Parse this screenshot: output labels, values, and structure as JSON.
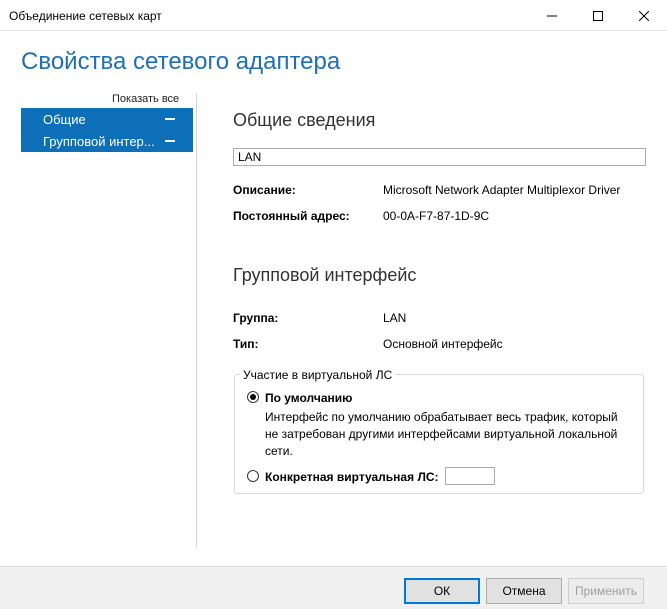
{
  "window": {
    "title": "Объединение сетевых карт"
  },
  "page": {
    "heading": "Свойства сетевого адаптера"
  },
  "nav": {
    "show_all": "Показать все",
    "items": [
      {
        "label": "Общие"
      },
      {
        "label": "Групповой интер..."
      }
    ]
  },
  "general": {
    "title": "Общие сведения",
    "name_value": "LAN",
    "description_label": "Описание:",
    "description_value": "Microsoft Network Adapter Multiplexor Driver",
    "address_label": "Постоянный адрес:",
    "address_value": "00-0A-F7-87-1D-9C"
  },
  "team_interface": {
    "title": "Групповой интерфейс",
    "group_label": "Группа:",
    "group_value": "LAN",
    "type_label": "Тип:",
    "type_value": "Основной интерфейс"
  },
  "vlan": {
    "legend": "Участие в виртуальной ЛС",
    "default_label": "По умолчанию",
    "default_description": "Интерфейс по умолчанию обрабатывает весь трафик, который не затребован другими интерфейсами виртуальной локальной сети.",
    "specific_label": "Конкретная виртуальная ЛС:",
    "specific_value": "",
    "selected": "default"
  },
  "buttons": {
    "ok": "ОК",
    "cancel": "Отмена",
    "apply": "Применить"
  },
  "colors": {
    "accent": "#0d6fb8",
    "heading": "#1e6fb4"
  }
}
